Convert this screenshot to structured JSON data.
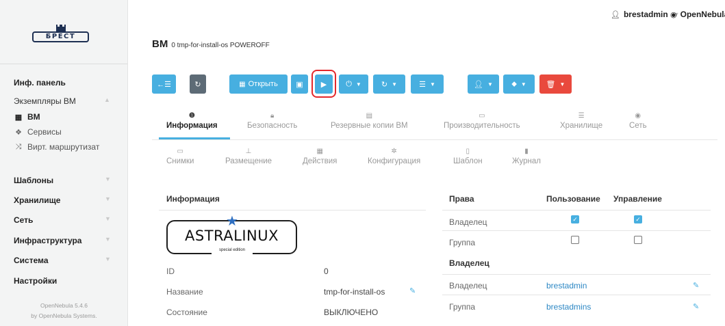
{
  "brand": {
    "logo_text": "БРЕСТ"
  },
  "sidebar": {
    "items": [
      {
        "label": "Инф. панель"
      },
      {
        "label": "Экземпляры ВМ"
      },
      {
        "label": "ВМ",
        "icon": "grid-icon"
      },
      {
        "label": "Сервисы",
        "icon": "cubes-icon"
      },
      {
        "label": "Вирт. маршрутизат",
        "icon": "shuffle-icon"
      },
      {
        "label": "Шаблоны"
      },
      {
        "label": "Хранилище"
      },
      {
        "label": "Сеть"
      },
      {
        "label": "Инфраструктура"
      },
      {
        "label": "Система"
      },
      {
        "label": "Настройки"
      }
    ],
    "footer_version": "OpenNebula 5.4.6",
    "footer_by": "by OpenNebula Systems."
  },
  "topbar": {
    "user": "brestadmin",
    "zone": "OpenNebula"
  },
  "page": {
    "title_main": "ВМ",
    "title_sub": "0 tmp-for-install-os POWEROFF"
  },
  "toolbar": {
    "open_label": "Открыть",
    "highlight_color": "#e4282b",
    "accent": "#47afe0",
    "danger": "#e9493d",
    "neutral": "#5d6b76"
  },
  "tabs_row1": [
    {
      "label": "Информация",
      "icon": "info-icon"
    },
    {
      "label": "Безопасность",
      "icon": "lock-icon"
    },
    {
      "label": "Резервные копии ВМ",
      "icon": "archive-icon"
    },
    {
      "label": "Производительность",
      "icon": "monitor-icon"
    },
    {
      "label": "Хранилище",
      "icon": "storage-icon"
    },
    {
      "label": "Сеть",
      "icon": "globe-icon"
    }
  ],
  "tabs_row2": [
    {
      "label": "Снимки",
      "icon": "laptop-icon"
    },
    {
      "label": "Размещение",
      "icon": "sitemap-icon"
    },
    {
      "label": "Действия",
      "icon": "calendar-icon"
    },
    {
      "label": "Конфигурация",
      "icon": "gear-icon"
    },
    {
      "label": "Шаблон",
      "icon": "file-icon"
    },
    {
      "label": "Журнал",
      "icon": "log-icon"
    }
  ],
  "info": {
    "title": "Информация",
    "logo_name": "ASTRALINUX",
    "logo_sub": "special edition",
    "rows": [
      {
        "label": "ID",
        "value": "0"
      },
      {
        "label": "Название",
        "value": "tmp-for-install-os"
      },
      {
        "label": "Состояние",
        "value": "ВЫКЛЮЧЕНО"
      }
    ]
  },
  "permissions": {
    "title": "Права",
    "col_use": "Пользование",
    "col_manage": "Управление",
    "rows": [
      {
        "label": "Владелец",
        "use": true,
        "manage": true
      },
      {
        "label": "Группа",
        "use": false,
        "manage": false
      }
    ]
  },
  "ownership": {
    "title": "Владелец",
    "rows": [
      {
        "label": "Владелец",
        "value": "brestadmin"
      },
      {
        "label": "Группа",
        "value": "brestadmins"
      }
    ]
  }
}
